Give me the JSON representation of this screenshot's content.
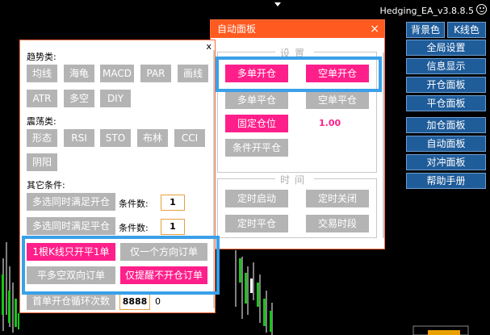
{
  "app": {
    "version": "Hedging_EA_v3.8.8.5"
  },
  "right_menu": {
    "bg_color": "背景色",
    "kline_color": "K线色",
    "items": [
      "全局设置",
      "信息显示",
      "开仓面板",
      "平仓面板",
      "加仓面板",
      "自动面板",
      "对冲面板",
      "帮助手册"
    ]
  },
  "auto_panel": {
    "title": "自动面板",
    "close": "×",
    "settings_title": "设置",
    "multi_open": "多单开仓",
    "short_open": "空单开仓",
    "multi_close": "多单平仓",
    "short_close": "空单平仓",
    "fixed_lot": "固定仓位",
    "fixed_lot_value": "1.00",
    "cond_close": "条件开平仓",
    "time_title": "时间",
    "timer_start": "定时启动",
    "timer_close": "定时关闭",
    "timer_flat": "定时平仓",
    "trade_time": "交易时段"
  },
  "cond_panel": {
    "close": "x",
    "trend_label": "趋势类:",
    "trend_buttons": [
      "均线",
      "海龟",
      "MACD",
      "PAR",
      "画线",
      "ATR",
      "多空",
      "DIY"
    ],
    "osc_label": "震荡类:",
    "osc_buttons": [
      "形态",
      "RSI",
      "STO",
      "布林",
      "CCI",
      "阴阳"
    ],
    "other_label": "其它条件:",
    "multi_open_cond": "多选同时满足开仓",
    "multi_close_cond": "多选同时满足平仓",
    "cond_count_label": "条件数:",
    "cond_count_open": "1",
    "cond_count_close": "1",
    "one_k_once": "1根K线只开平1单",
    "one_direction": "仅一个方向订单",
    "flat_bidirectional": "平多空双向订单",
    "remind_only": "仅提醒不开仓订单",
    "loop_count_label": "首单开仓循环次数",
    "loop_count_value": "8888",
    "loop_count_extra": "0"
  },
  "colors": {
    "accent_orange": "#ff5a1f",
    "pink": "#ff1f8a",
    "gray": "#b4b4b4",
    "blue_menu": "#1f5c9a",
    "highlight": "#3aa0e8"
  }
}
